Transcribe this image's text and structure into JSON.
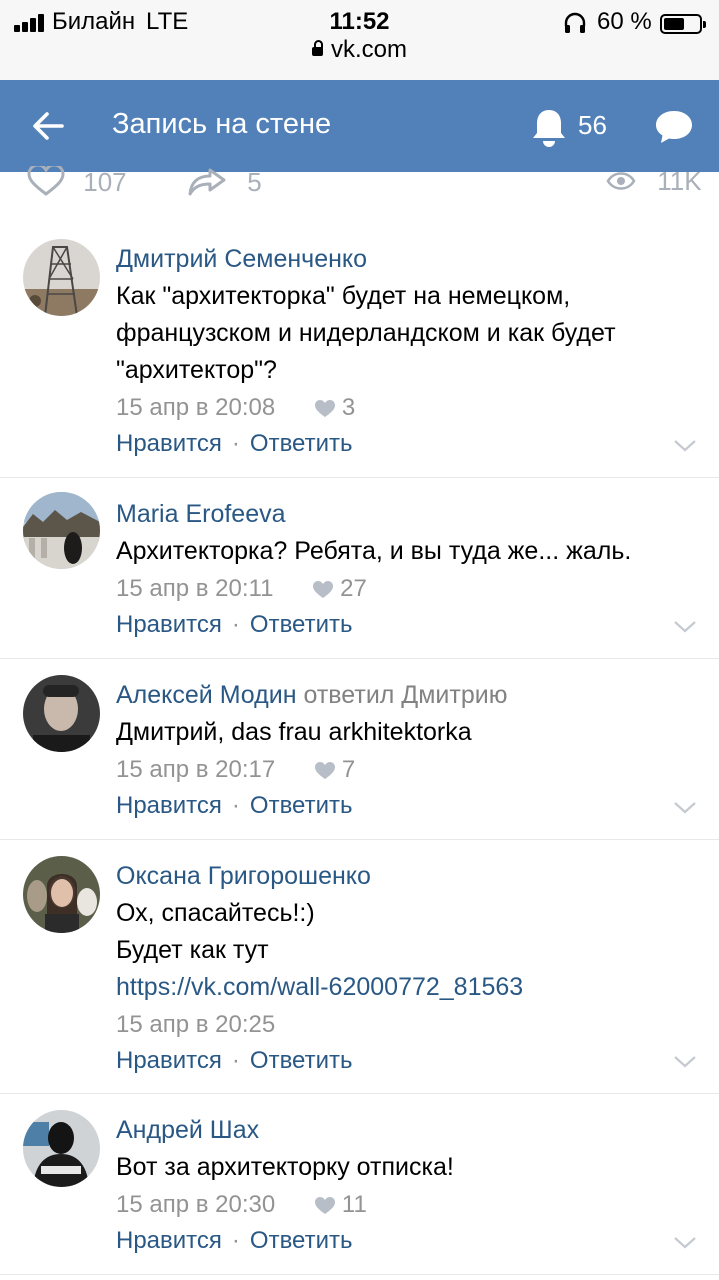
{
  "status": {
    "carrier": "Билайн",
    "network": "LTE",
    "time": "11:52",
    "battery": "60 %",
    "battery_level": 0.6,
    "url": "vk.com"
  },
  "header": {
    "title": "Запись на стене",
    "notifications": "56",
    "bg_color": "#5181b8"
  },
  "stats": {
    "likes": "107",
    "shares": "5",
    "views": "11K"
  },
  "actions": {
    "like": "Нравится",
    "sep": "·",
    "reply": "Ответить"
  },
  "comments": [
    {
      "author": "Дмитрий Семенченко",
      "reply_to": "",
      "lines": [
        "Как \"архитекторка\" будет на немецком, французском и нидерландском и как будет \"архитектор\"?"
      ],
      "link": "",
      "date": "15 апр в 20:08",
      "likes": "3"
    },
    {
      "author": "Maria Erofeeva",
      "reply_to": "",
      "lines": [
        "Архитекторка? Ребята, и вы туда же... жаль."
      ],
      "link": "",
      "date": "15 апр в 20:11",
      "likes": "27"
    },
    {
      "author": "Алексей Модин",
      "reply_to": "ответил Дмитрию",
      "lines": [
        "Дмитрий, das frau arkhitektorka"
      ],
      "link": "",
      "date": "15 апр в 20:17",
      "likes": "7"
    },
    {
      "author": "Оксана Григорошенко",
      "reply_to": "",
      "lines": [
        "Ох, спасайтесь!:)",
        "Будет как тут"
      ],
      "link": "https://vk.com/wall-62000772_81563",
      "date": "15 апр в 20:25",
      "likes": ""
    },
    {
      "author": "Андрей Шах",
      "reply_to": "",
      "lines": [
        "Вот за архитекторку отписка!"
      ],
      "link": "",
      "date": "15 апр в 20:30",
      "likes": "11"
    }
  ]
}
